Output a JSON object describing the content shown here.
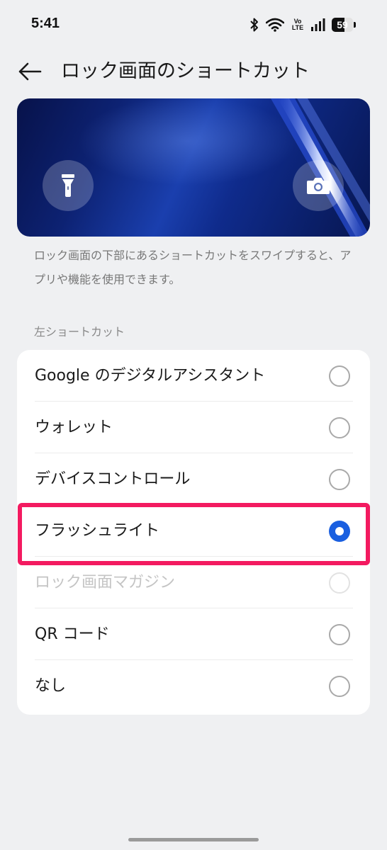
{
  "status_bar": {
    "time": "5:41",
    "volte_top": "Vo",
    "volte_bottom": "LTE",
    "battery_level": "59",
    "icons": [
      "bluetooth-icon",
      "wifi-icon",
      "volte-icon",
      "signal-icon",
      "battery-icon"
    ]
  },
  "header": {
    "back_icon": "arrow-left-icon",
    "title": "ロック画面のショートカット"
  },
  "preview": {
    "left_icon": "flashlight-icon",
    "right_icon": "camera-icon"
  },
  "description": "ロック画面の下部にあるショートカットをスワイプすると、アプリや機能を使用できます。",
  "section_label": "左ショートカット",
  "options": [
    {
      "label": "Google のデジタルアシスタント",
      "state": "unchecked"
    },
    {
      "label": "ウォレット",
      "state": "unchecked"
    },
    {
      "label": "デバイスコントロール",
      "state": "unchecked"
    },
    {
      "label": "フラッシュライト",
      "state": "checked"
    },
    {
      "label": "ロック画面マガジン",
      "state": "disabled"
    },
    {
      "label": "QR コード",
      "state": "unchecked"
    },
    {
      "label": "なし",
      "state": "unchecked"
    }
  ],
  "colors": {
    "accent": "#1a5fe0",
    "highlight": "#f31a60",
    "background": "#eff0f2"
  }
}
